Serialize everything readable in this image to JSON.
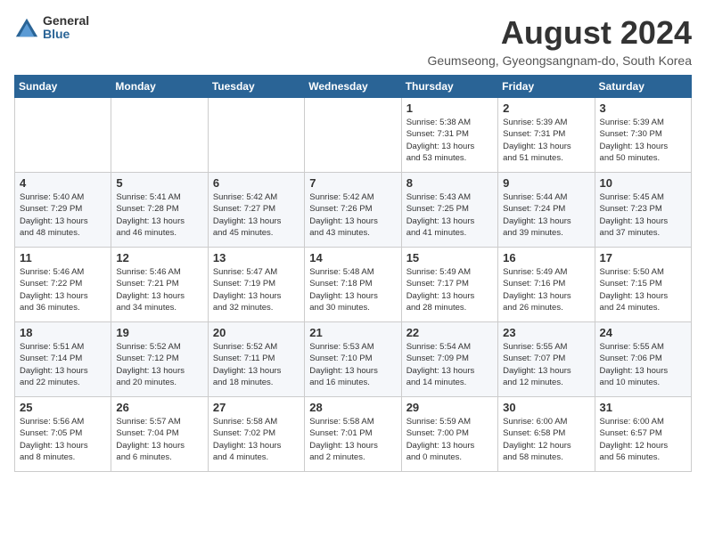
{
  "logo": {
    "general": "General",
    "blue": "Blue"
  },
  "title": "August 2024",
  "subtitle": "Geumseong, Gyeongsangnam-do, South Korea",
  "headers": [
    "Sunday",
    "Monday",
    "Tuesday",
    "Wednesday",
    "Thursday",
    "Friday",
    "Saturday"
  ],
  "weeks": [
    [
      {
        "day": "",
        "info": ""
      },
      {
        "day": "",
        "info": ""
      },
      {
        "day": "",
        "info": ""
      },
      {
        "day": "",
        "info": ""
      },
      {
        "day": "1",
        "info": "Sunrise: 5:38 AM\nSunset: 7:31 PM\nDaylight: 13 hours\nand 53 minutes."
      },
      {
        "day": "2",
        "info": "Sunrise: 5:39 AM\nSunset: 7:31 PM\nDaylight: 13 hours\nand 51 minutes."
      },
      {
        "day": "3",
        "info": "Sunrise: 5:39 AM\nSunset: 7:30 PM\nDaylight: 13 hours\nand 50 minutes."
      }
    ],
    [
      {
        "day": "4",
        "info": "Sunrise: 5:40 AM\nSunset: 7:29 PM\nDaylight: 13 hours\nand 48 minutes."
      },
      {
        "day": "5",
        "info": "Sunrise: 5:41 AM\nSunset: 7:28 PM\nDaylight: 13 hours\nand 46 minutes."
      },
      {
        "day": "6",
        "info": "Sunrise: 5:42 AM\nSunset: 7:27 PM\nDaylight: 13 hours\nand 45 minutes."
      },
      {
        "day": "7",
        "info": "Sunrise: 5:42 AM\nSunset: 7:26 PM\nDaylight: 13 hours\nand 43 minutes."
      },
      {
        "day": "8",
        "info": "Sunrise: 5:43 AM\nSunset: 7:25 PM\nDaylight: 13 hours\nand 41 minutes."
      },
      {
        "day": "9",
        "info": "Sunrise: 5:44 AM\nSunset: 7:24 PM\nDaylight: 13 hours\nand 39 minutes."
      },
      {
        "day": "10",
        "info": "Sunrise: 5:45 AM\nSunset: 7:23 PM\nDaylight: 13 hours\nand 37 minutes."
      }
    ],
    [
      {
        "day": "11",
        "info": "Sunrise: 5:46 AM\nSunset: 7:22 PM\nDaylight: 13 hours\nand 36 minutes."
      },
      {
        "day": "12",
        "info": "Sunrise: 5:46 AM\nSunset: 7:21 PM\nDaylight: 13 hours\nand 34 minutes."
      },
      {
        "day": "13",
        "info": "Sunrise: 5:47 AM\nSunset: 7:19 PM\nDaylight: 13 hours\nand 32 minutes."
      },
      {
        "day": "14",
        "info": "Sunrise: 5:48 AM\nSunset: 7:18 PM\nDaylight: 13 hours\nand 30 minutes."
      },
      {
        "day": "15",
        "info": "Sunrise: 5:49 AM\nSunset: 7:17 PM\nDaylight: 13 hours\nand 28 minutes."
      },
      {
        "day": "16",
        "info": "Sunrise: 5:49 AM\nSunset: 7:16 PM\nDaylight: 13 hours\nand 26 minutes."
      },
      {
        "day": "17",
        "info": "Sunrise: 5:50 AM\nSunset: 7:15 PM\nDaylight: 13 hours\nand 24 minutes."
      }
    ],
    [
      {
        "day": "18",
        "info": "Sunrise: 5:51 AM\nSunset: 7:14 PM\nDaylight: 13 hours\nand 22 minutes."
      },
      {
        "day": "19",
        "info": "Sunrise: 5:52 AM\nSunset: 7:12 PM\nDaylight: 13 hours\nand 20 minutes."
      },
      {
        "day": "20",
        "info": "Sunrise: 5:52 AM\nSunset: 7:11 PM\nDaylight: 13 hours\nand 18 minutes."
      },
      {
        "day": "21",
        "info": "Sunrise: 5:53 AM\nSunset: 7:10 PM\nDaylight: 13 hours\nand 16 minutes."
      },
      {
        "day": "22",
        "info": "Sunrise: 5:54 AM\nSunset: 7:09 PM\nDaylight: 13 hours\nand 14 minutes."
      },
      {
        "day": "23",
        "info": "Sunrise: 5:55 AM\nSunset: 7:07 PM\nDaylight: 13 hours\nand 12 minutes."
      },
      {
        "day": "24",
        "info": "Sunrise: 5:55 AM\nSunset: 7:06 PM\nDaylight: 13 hours\nand 10 minutes."
      }
    ],
    [
      {
        "day": "25",
        "info": "Sunrise: 5:56 AM\nSunset: 7:05 PM\nDaylight: 13 hours\nand 8 minutes."
      },
      {
        "day": "26",
        "info": "Sunrise: 5:57 AM\nSunset: 7:04 PM\nDaylight: 13 hours\nand 6 minutes."
      },
      {
        "day": "27",
        "info": "Sunrise: 5:58 AM\nSunset: 7:02 PM\nDaylight: 13 hours\nand 4 minutes."
      },
      {
        "day": "28",
        "info": "Sunrise: 5:58 AM\nSunset: 7:01 PM\nDaylight: 13 hours\nand 2 minutes."
      },
      {
        "day": "29",
        "info": "Sunrise: 5:59 AM\nSunset: 7:00 PM\nDaylight: 13 hours\nand 0 minutes."
      },
      {
        "day": "30",
        "info": "Sunrise: 6:00 AM\nSunset: 6:58 PM\nDaylight: 12 hours\nand 58 minutes."
      },
      {
        "day": "31",
        "info": "Sunrise: 6:00 AM\nSunset: 6:57 PM\nDaylight: 12 hours\nand 56 minutes."
      }
    ]
  ]
}
